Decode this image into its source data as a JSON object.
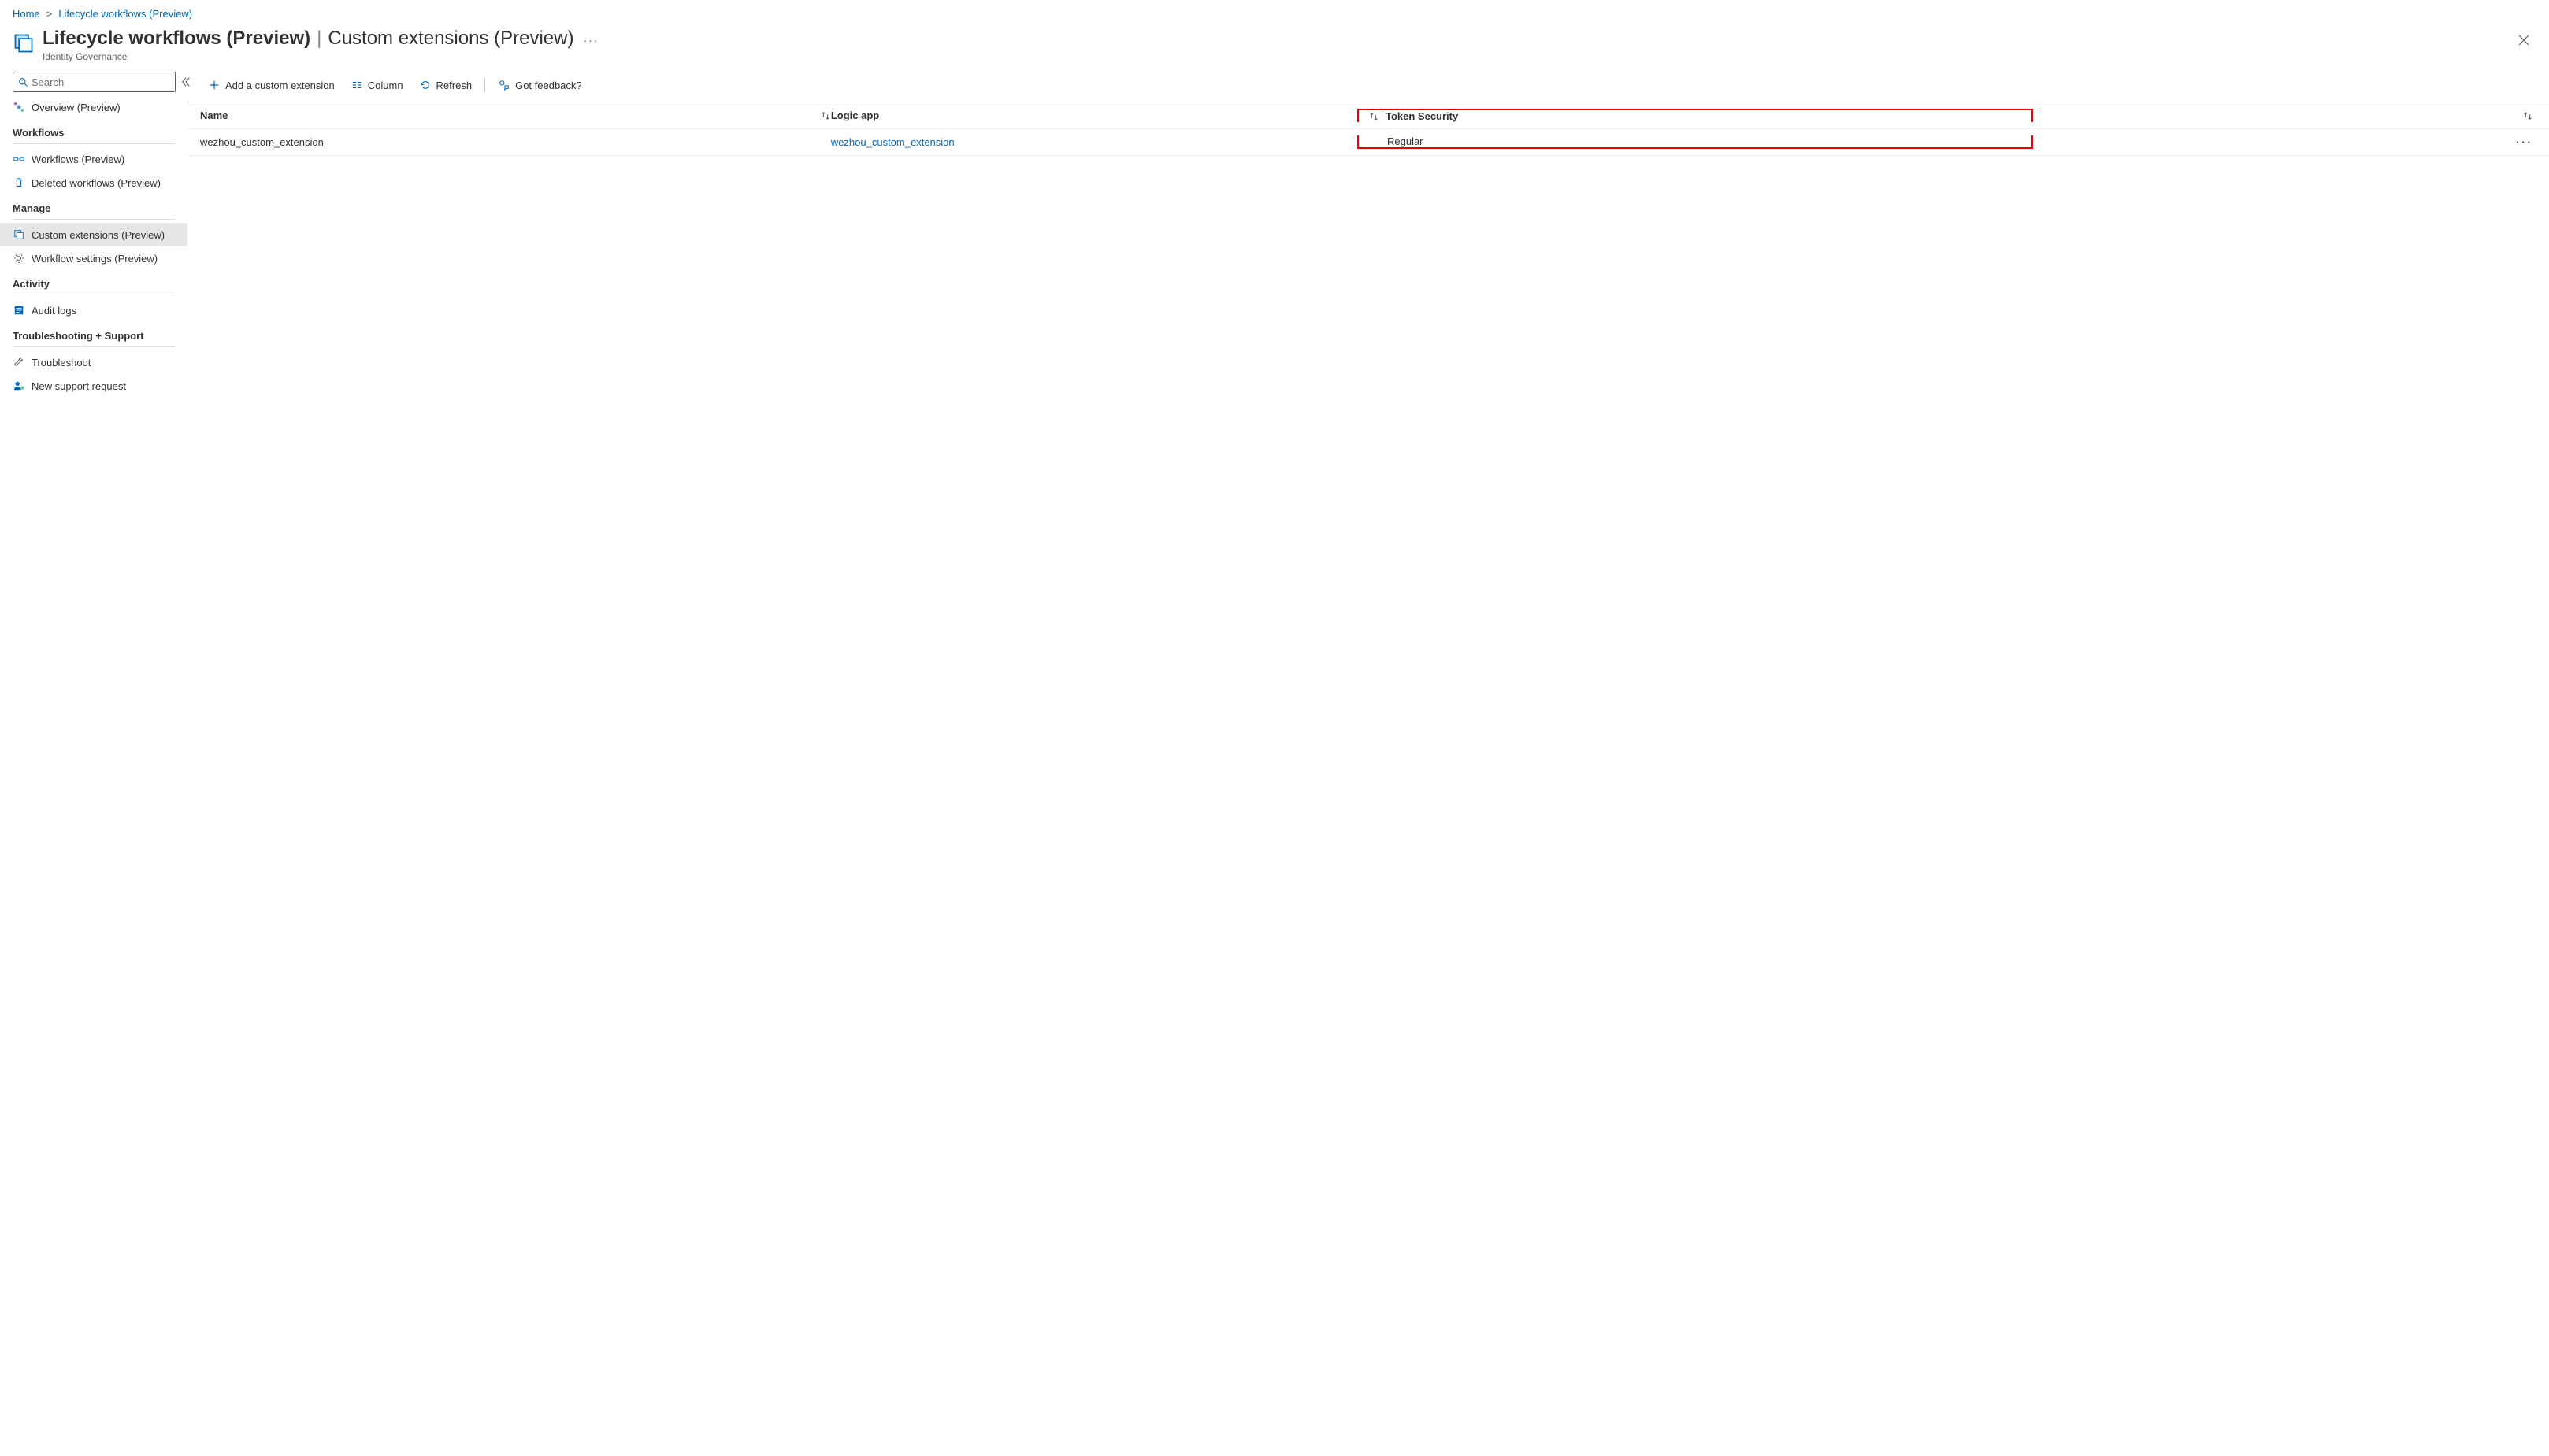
{
  "breadcrumb": {
    "home": "Home",
    "current": "Lifecycle workflows (Preview)"
  },
  "page": {
    "title": "Lifecycle workflows (Preview)",
    "section": "Custom extensions (Preview)",
    "subtitle": "Identity Governance"
  },
  "search": {
    "placeholder": "Search"
  },
  "sidebar": {
    "overview": "Overview (Preview)",
    "sections": {
      "workflows": "Workflows",
      "manage": "Manage",
      "activity": "Activity",
      "support": "Troubleshooting + Support"
    },
    "items": {
      "workflows": "Workflows (Preview)",
      "deleted": "Deleted workflows (Preview)",
      "custom_ext": "Custom extensions (Preview)",
      "settings": "Workflow settings (Preview)",
      "audit": "Audit logs",
      "troubleshoot": "Troubleshoot",
      "support_req": "New support request"
    }
  },
  "toolbar": {
    "add": "Add a custom extension",
    "column": "Column",
    "refresh": "Refresh",
    "feedback": "Got feedback?"
  },
  "table": {
    "columns": {
      "name": "Name",
      "logic_app": "Logic app",
      "token_security": "Token Security"
    },
    "rows": [
      {
        "name": "wezhou_custom_extension",
        "logic_app": "wezhou_custom_extension",
        "token_security": "Regular"
      }
    ]
  }
}
